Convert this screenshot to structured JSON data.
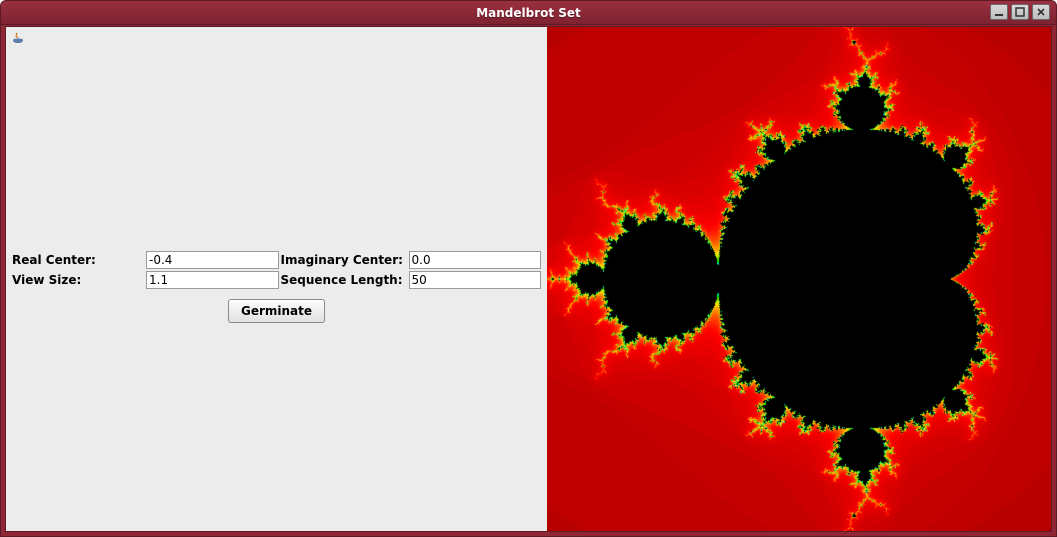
{
  "window": {
    "title": "Mandelbrot Set"
  },
  "form": {
    "real_center": {
      "label": "Real Center:",
      "value": "-0.4"
    },
    "imag_center": {
      "label": "Imaginary Center:",
      "value": "0.0"
    },
    "view_size": {
      "label": "View Size:",
      "value": "1.1"
    },
    "seq_length": {
      "label": "Sequence Length:",
      "value": "50"
    }
  },
  "action": {
    "germinate_label": "Germinate"
  },
  "fractal": {
    "real_center": -0.4,
    "imag_center": 0.0,
    "half_extent": 1.1,
    "max_iter": 50
  }
}
